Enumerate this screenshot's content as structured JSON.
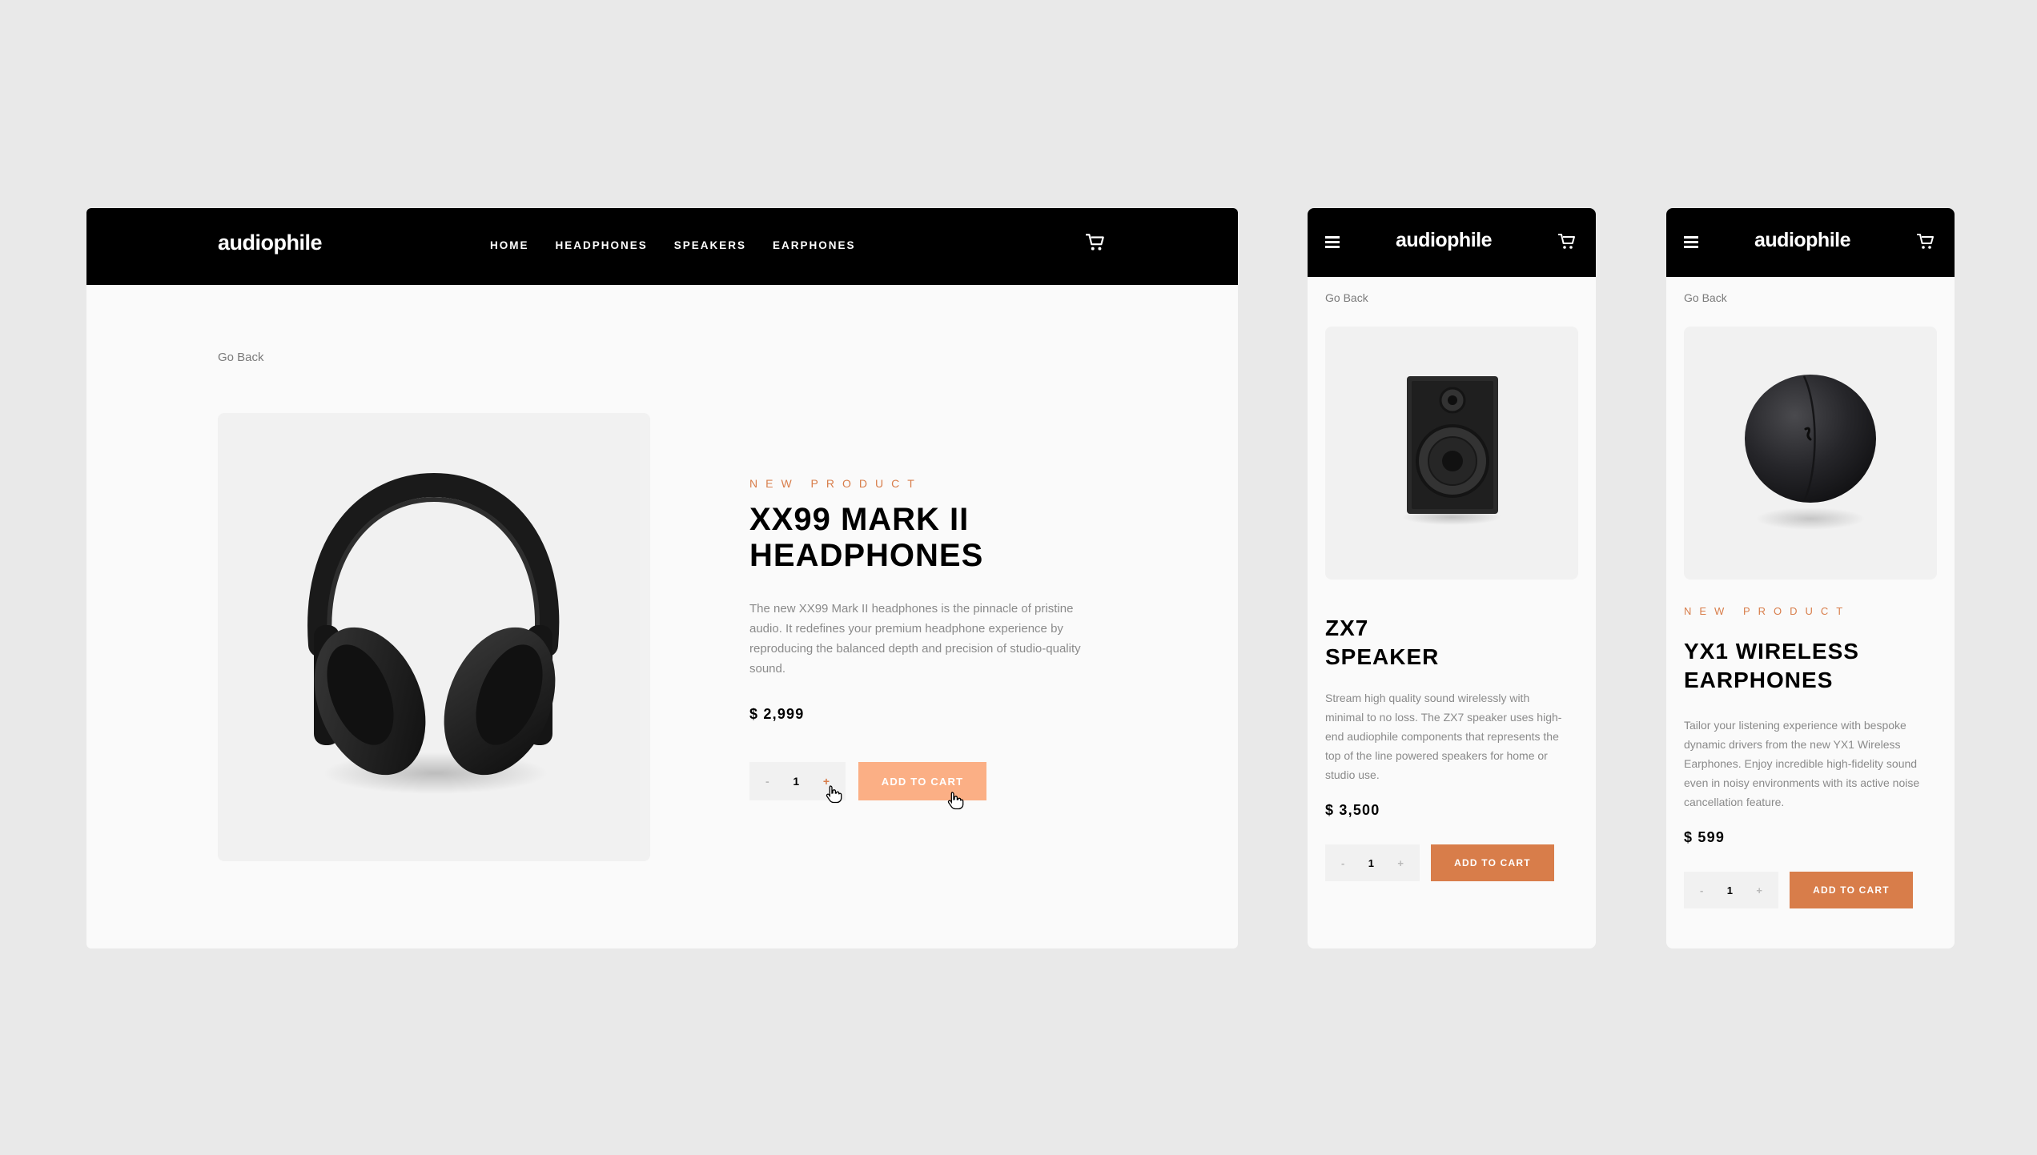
{
  "colors": {
    "accent": "#d87d4a",
    "accent_hover": "#fbaf85",
    "nav_bg": "#000000",
    "page_bg": "#e9e9e9"
  },
  "desktop": {
    "logo": "audiophile",
    "nav": [
      "HOME",
      "HEADPHONES",
      "SPEAKERS",
      "EARPHONES"
    ],
    "cart_icon": "cart-icon",
    "go_back": "Go Back",
    "product": {
      "overline": "NEW PRODUCT",
      "title_line1": "XX99 MARK II",
      "title_line2": "HEADPHONES",
      "description": "The new XX99 Mark II headphones is the pinnacle of pristine audio. It redefines your premium headphone experience by reproducing the balanced depth and precision of studio-quality sound.",
      "price": "$ 2,999",
      "qty_minus": "-",
      "quantity": "1",
      "qty_plus": "+",
      "add_to_cart": "ADD TO CART"
    }
  },
  "mobile_speaker": {
    "logo": "audiophile",
    "menu_icon": "hamburger-menu-icon",
    "cart_icon": "cart-icon",
    "go_back": "Go Back",
    "product": {
      "title_line1": "ZX7",
      "title_line2": "SPEAKER",
      "description": "Stream high quality sound wirelessly with minimal to no loss. The ZX7 speaker uses high-end audiophile components that represents the top of the line powered speakers for home or studio use.",
      "price": "$ 3,500",
      "qty_minus": "-",
      "quantity": "1",
      "qty_plus": "+",
      "add_to_cart": "ADD TO CART"
    }
  },
  "mobile_earphones": {
    "logo": "audiophile",
    "menu_icon": "hamburger-menu-icon",
    "cart_icon": "cart-icon",
    "go_back": "Go Back",
    "product": {
      "overline": "NEW PRODUCT",
      "title_line1": "YX1 WIRELESS",
      "title_line2": "EARPHONES",
      "description": "Tailor your listening experience with bespoke dynamic drivers from the new YX1 Wireless Earphones. Enjoy incredible high-fidelity sound even in noisy environments with its active noise cancellation feature.",
      "price": "$ 599",
      "qty_minus": "-",
      "quantity": "1",
      "qty_plus": "+",
      "add_to_cart": "ADD TO CART"
    }
  }
}
